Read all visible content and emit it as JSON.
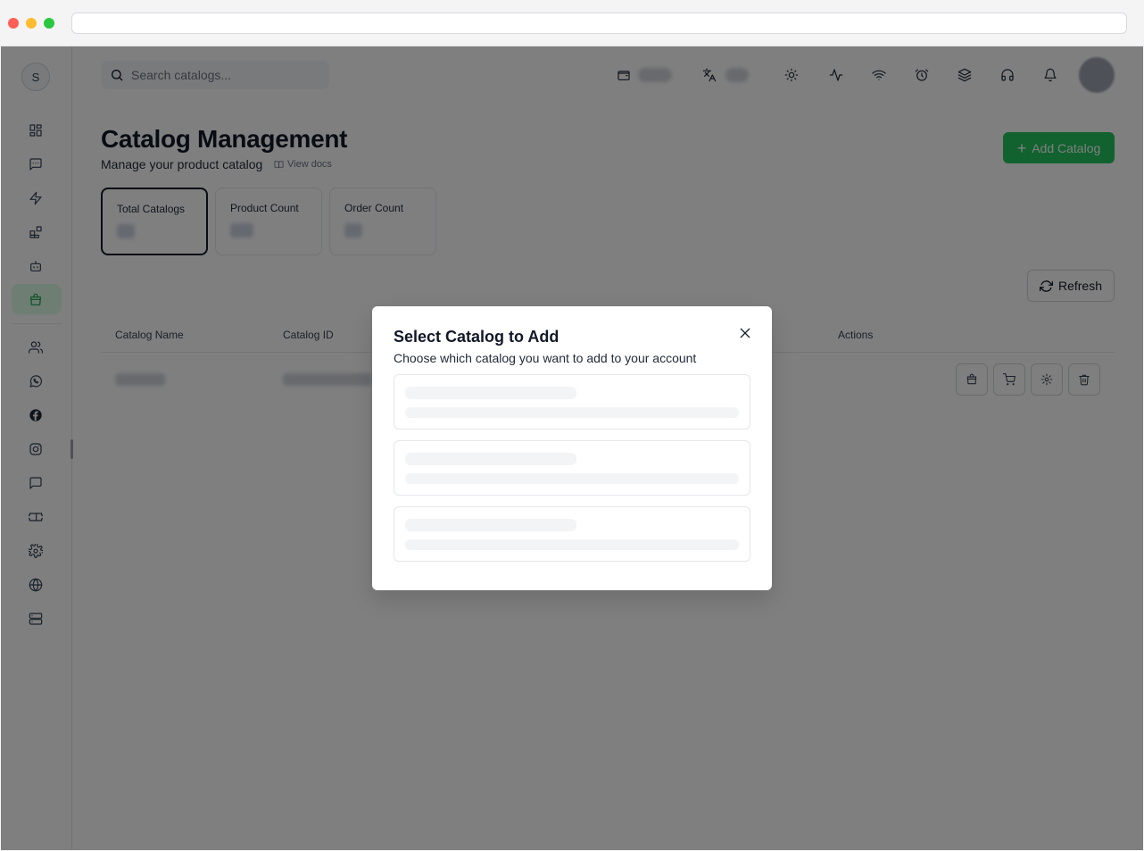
{
  "search": {
    "placeholder": "Search catalogs..."
  },
  "header": {
    "title": "Catalog Management",
    "subtitle": "Manage your product catalog",
    "docs_link": "View docs",
    "add_button": "Add Catalog"
  },
  "stats": [
    {
      "label": "Total Catalogs"
    },
    {
      "label": "Product Count"
    },
    {
      "label": "Order Count"
    }
  ],
  "refresh_label": "Refresh",
  "table": {
    "columns": [
      "Catalog Name",
      "Catalog ID",
      "Actions"
    ]
  },
  "modal": {
    "title": "Select Catalog to Add",
    "description": "Choose which catalog you want to add to your account"
  },
  "sidebar": {
    "avatar_initial": "S",
    "icons": [
      "dashboard-icon",
      "chat-icon",
      "bolt-icon",
      "apps-icon",
      "bot-icon",
      "store-icon",
      "users-icon",
      "whatsapp-icon",
      "facebook-icon",
      "instagram-icon",
      "message-icon",
      "ticket-icon",
      "settings-icon",
      "globe-icon",
      "server-icon"
    ]
  },
  "colors": {
    "accent": "#22c55e",
    "active_bg": "#dcfce7"
  }
}
